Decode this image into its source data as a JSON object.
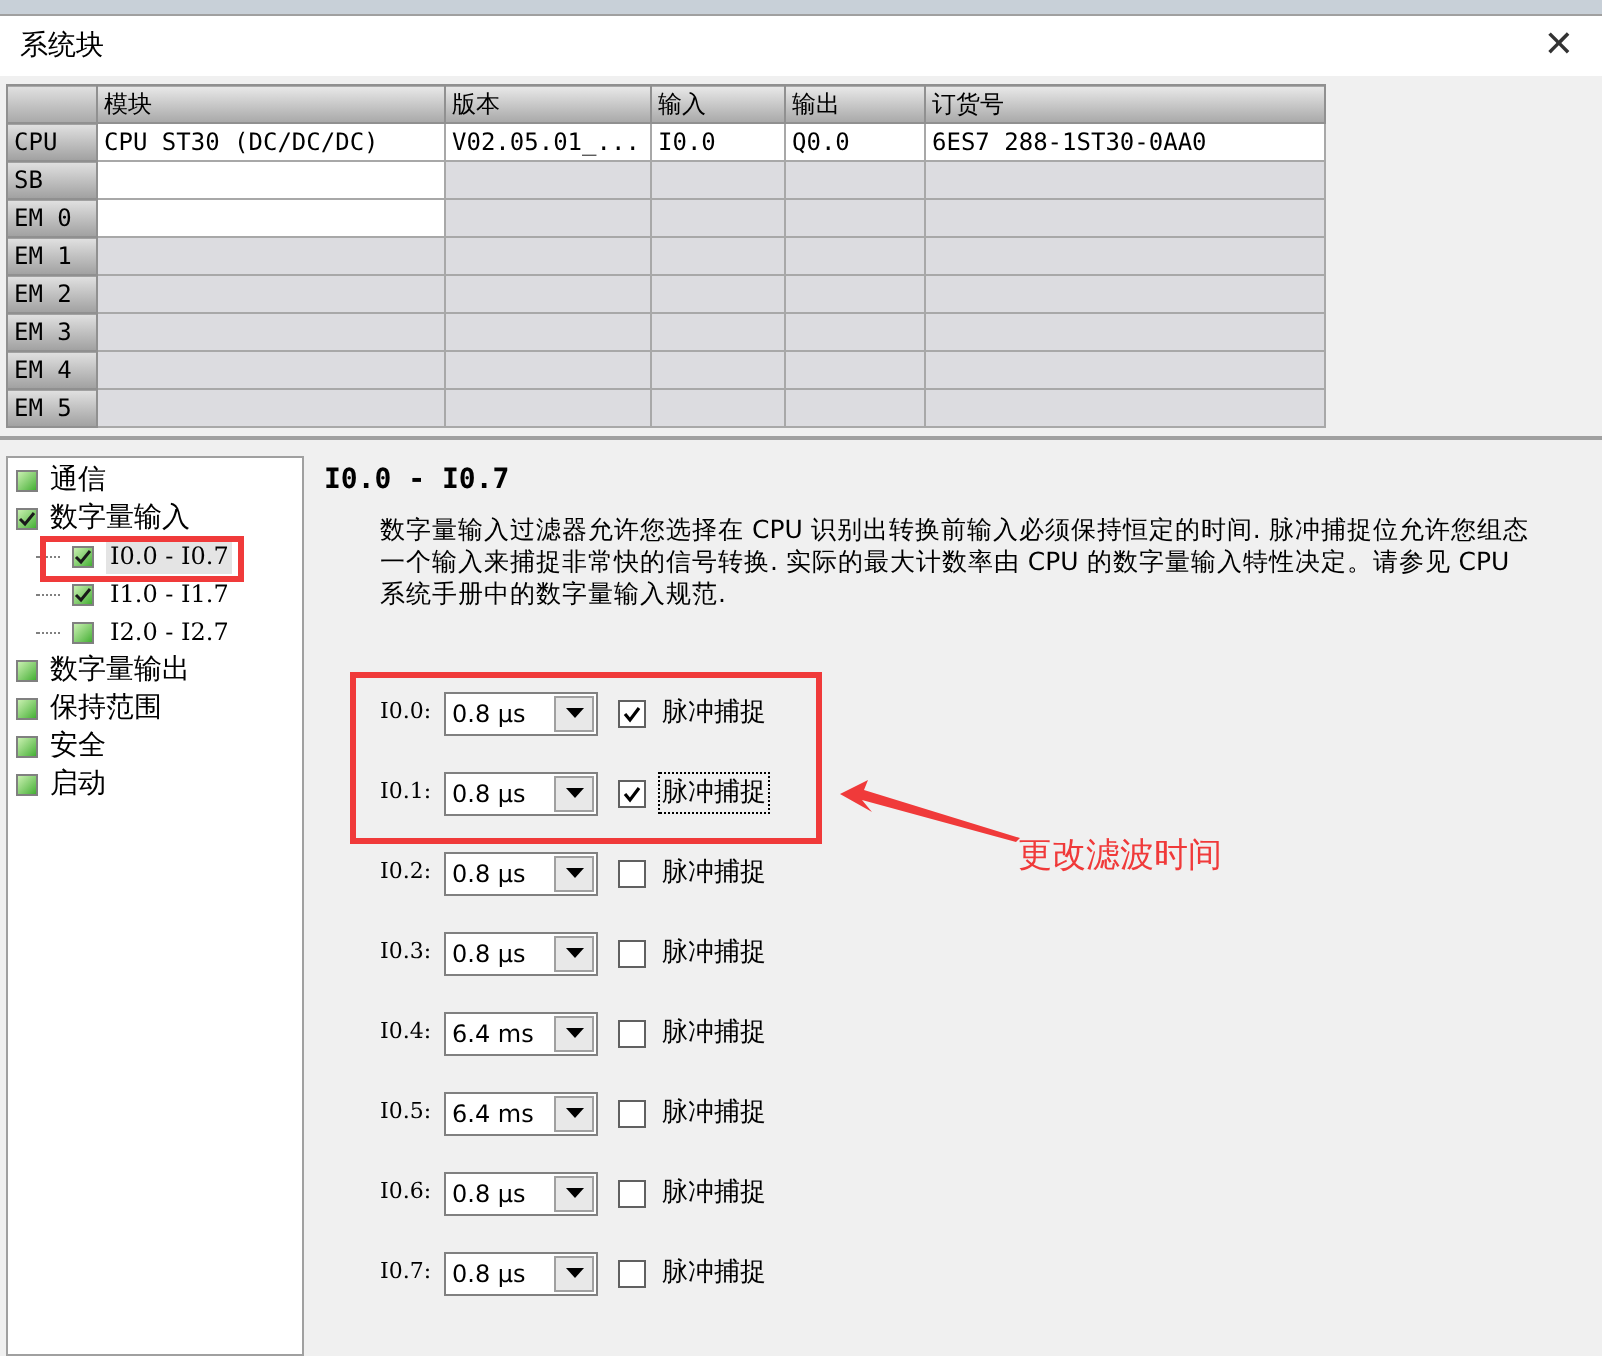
{
  "window": {
    "title": "系统块",
    "close": "✕"
  },
  "table": {
    "columns": [
      "模块",
      "版本",
      "输入",
      "输出",
      "订货号"
    ],
    "rows": [
      {
        "header": "CPU",
        "cells": [
          "CPU ST30 (DC/DC/DC)",
          "V02.05.01_...",
          "I0.0",
          "Q0.0",
          "6ES7 288-1ST30-0AA0"
        ],
        "editable": true
      },
      {
        "header": "SB",
        "cells": [],
        "editable": true
      },
      {
        "header": "EM 0",
        "cells": [],
        "editable": true
      },
      {
        "header": "EM 1",
        "cells": [],
        "editable": false
      },
      {
        "header": "EM 2",
        "cells": [],
        "editable": false
      },
      {
        "header": "EM 3",
        "cells": [],
        "editable": false
      },
      {
        "header": "EM 4",
        "cells": [],
        "editable": false
      },
      {
        "header": "EM 5",
        "cells": [],
        "editable": false
      }
    ]
  },
  "tree": [
    {
      "label": "通信",
      "selected": false,
      "checked": false
    },
    {
      "label": "数字量输入",
      "selected": false,
      "checked": true,
      "children": [
        {
          "label": "I0.0 - I0.7",
          "selected": true,
          "checked": true
        },
        {
          "label": "I1.0 - I1.7",
          "selected": false,
          "checked": true
        },
        {
          "label": "I2.0 - I2.7",
          "selected": false,
          "checked": false
        }
      ]
    },
    {
      "label": "数字量输出",
      "selected": false,
      "checked": false
    },
    {
      "label": "保持范围",
      "selected": false,
      "checked": false
    },
    {
      "label": "安全",
      "selected": false,
      "checked": false
    },
    {
      "label": "启动",
      "selected": false,
      "checked": false
    }
  ],
  "panel": {
    "heading": "I0.0 - I0.7",
    "description": "数字量输入过滤器允许您选择在 CPU 识别出转换前输入必须保持恒定的时间. 脉冲捕捉位允许您组态一个输入来捕捉非常快的信号转换. 实际的最大计数率由 CPU 的数字量输入特性决定。请参见 CPU 系统手册中的数字量输入规范.",
    "inputs": [
      {
        "label": "I0.0:",
        "filter": "0.8 µs",
        "pulse_label": "脉冲捕捉",
        "checked": true,
        "focused": false
      },
      {
        "label": "I0.1:",
        "filter": "0.8 µs",
        "pulse_label": "脉冲捕捉",
        "checked": true,
        "focused": true
      },
      {
        "label": "I0.2:",
        "filter": "0.8 µs",
        "pulse_label": "脉冲捕捉",
        "checked": false,
        "focused": false
      },
      {
        "label": "I0.3:",
        "filter": "0.8 µs",
        "pulse_label": "脉冲捕捉",
        "checked": false,
        "focused": false
      },
      {
        "label": "I0.4:",
        "filter": "6.4 ms",
        "pulse_label": "脉冲捕捉",
        "checked": false,
        "focused": false
      },
      {
        "label": "I0.5:",
        "filter": "6.4 ms",
        "pulse_label": "脉冲捕捉",
        "checked": false,
        "focused": false
      },
      {
        "label": "I0.6:",
        "filter": "0.8 µs",
        "pulse_label": "脉冲捕捉",
        "checked": false,
        "focused": false
      },
      {
        "label": "I0.7:",
        "filter": "0.8 µs",
        "pulse_label": "脉冲捕捉",
        "checked": false,
        "focused": false
      }
    ]
  },
  "annotation": {
    "text": "更改滤波时间"
  }
}
